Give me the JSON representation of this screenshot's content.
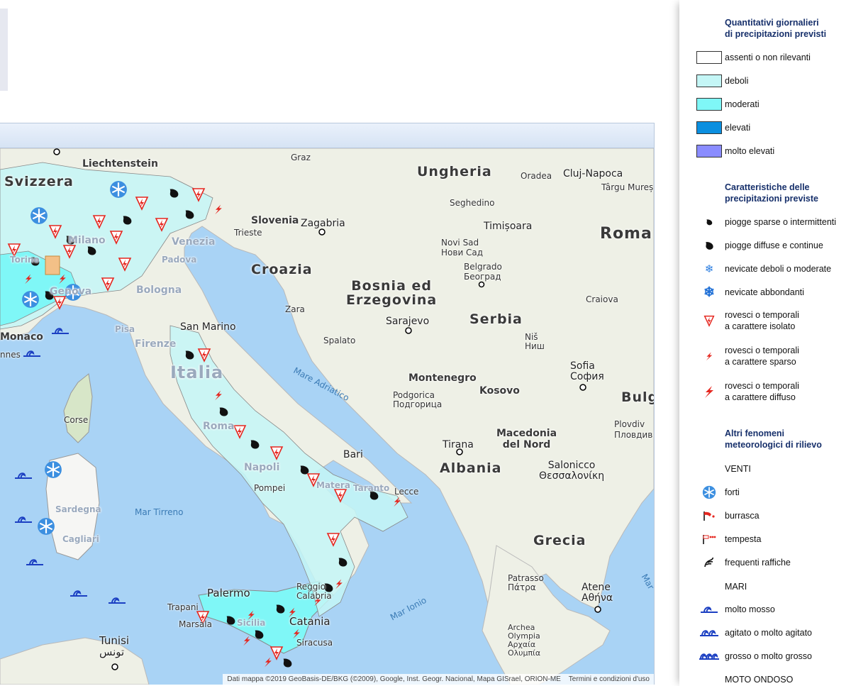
{
  "map": {
    "countries": {
      "svizzera": "Svizzera",
      "liechtenstein": "Liechtenstein",
      "ungheria": "Ungheria",
      "romania": "Roma",
      "slovenia": "Slovenia",
      "croazia": "Croazia",
      "bosnia": "Bosnia ed\nErzegovina",
      "serbia": "Serbia",
      "montenegro": "Montenegro",
      "kosovo": "Kosovo",
      "macedonia": "Macedonia\ndel Nord",
      "albania": "Albania",
      "bulgaria": "Bulg",
      "grecia": "Grecia",
      "italia": "Italia",
      "monaco": "Monaco"
    },
    "cities": {
      "graz": "Graz",
      "oradea": "Oradea",
      "cluj": "Cluj-Napoca",
      "targu": "Târgu Mureș",
      "seghedino": "Seghedino",
      "timisoara": "Timișoara",
      "zagabria": "Zagabria",
      "trieste": "Trieste",
      "venezia": "Venezia",
      "padova": "Padova",
      "milano": "Milano",
      "torino": "Torino",
      "genova": "Genova",
      "bologna": "Bologna",
      "firenze": "Firenze",
      "sanmarino": "San Marino",
      "pisa": "Pisa",
      "novisad": "Novi Sad\nНови Сад",
      "belgrado": "Belgrado\nБеоград",
      "zara": "Zara",
      "sarajevo": "Sarajevo",
      "spalato": "Spalato",
      "craiova": "Craiova",
      "nis": "Niš\nНиш",
      "sofia": "Sofia\nСофия",
      "plovdiv": "Plovdiv\nПловдив",
      "podgorica": "Podgorica\nПодгорица",
      "tirana": "Tirana",
      "salonicco": "Salonicco\nΘεσσαλονίκη",
      "roma": "Roma",
      "bari": "Bari",
      "napoli": "Napoli",
      "pompei": "Pompei",
      "matera": "Matera",
      "taranto": "Taranto",
      "lecce": "Lecce",
      "corse": "Corse",
      "sardegna": "Sardegna",
      "cagliari": "Cagliari",
      "palermo": "Palermo",
      "trapani": "Trapani",
      "marsala": "Marsala",
      "sicilia": "Sicilia",
      "catania": "Catania",
      "siracusa": "Siracusa",
      "reggio": "Reggio\nCalabria",
      "tunisi": "Tunisi\nتونس",
      "patrasso": "Patrasso\nΠάτρα",
      "atene": "Atene\nΑθήνα",
      "olympia": "Archea\nOlympia\nΑρχαία\nΟλυμπία",
      "nnes": "nnes"
    },
    "seas": {
      "adriatico": "Mare Adriatico",
      "tirreno": "Mar Tirreno",
      "ionio": "Mar Ionio",
      "mar": "Mar"
    },
    "attribution": "Dati mappa ©2019 GeoBasis-DE/BKG (©2009), Google, Inst. Geogr. Nacional, Mapa GISrael, ORION-ME",
    "terms": "Termini e condizioni d'uso",
    "colors": {
      "sea": "#a9d3f5",
      "land": "#eef0e6",
      "weak": "#c4f6f6",
      "moderate": "#7ff7f7",
      "high": "#0b8fe0",
      "very_high": "#8a8cff",
      "none": "#ffffff"
    }
  },
  "legend": {
    "precip_quantity": {
      "title": "Quantitativi giornalieri\ndi precipitazioni previsti",
      "items": [
        {
          "label": "assenti o non rilevanti",
          "color": "#ffffff"
        },
        {
          "label": "deboli",
          "color": "#c4f6f6"
        },
        {
          "label": "moderati",
          "color": "#7ff7f7"
        },
        {
          "label": "elevati",
          "color": "#0b8fe0"
        },
        {
          "label": "molto elevati",
          "color": "#8a8cff"
        }
      ]
    },
    "precip_type": {
      "title": "Caratteristiche delle\nprecipitazioni previste",
      "items": [
        {
          "label": "piogge sparse o intermittenti",
          "icon": "small-drop-icon"
        },
        {
          "label": "piogge diffuse e continue",
          "icon": "drop-icon"
        },
        {
          "label": "nevicate deboli o moderate",
          "icon": "snowflake-small-icon"
        },
        {
          "label": "nevicate abbondanti",
          "icon": "snowflake-icon"
        },
        {
          "label": "rovesci o temporali\na carattere isolato",
          "icon": "isolated-storm-icon"
        },
        {
          "label": "rovesci o temporali\na carattere sparso",
          "icon": "scattered-storm-icon"
        },
        {
          "label": "rovesci o temporali\na carattere diffuso",
          "icon": "widespread-storm-icon"
        }
      ]
    },
    "other": {
      "title": "Altri fenomeni\nmeteorologici di rilievo",
      "venti_label": "VENTI",
      "wind_items": [
        {
          "label": "forti",
          "icon": "strong-wind-icon"
        },
        {
          "label": "burrasca",
          "icon": "gale-icon"
        },
        {
          "label": "tempesta",
          "icon": "storm-wind-icon"
        },
        {
          "label": "frequenti raffiche",
          "icon": "gust-icon"
        }
      ],
      "mari_label": "MARI",
      "sea_items": [
        {
          "label": "molto mosso",
          "icon": "rough-sea-icon"
        },
        {
          "label": "agitato o molto agitato",
          "icon": "very-rough-sea-icon"
        },
        {
          "label": "grosso o molto grosso",
          "icon": "high-sea-icon"
        }
      ],
      "moto_label": "MOTO ONDOSO"
    }
  }
}
